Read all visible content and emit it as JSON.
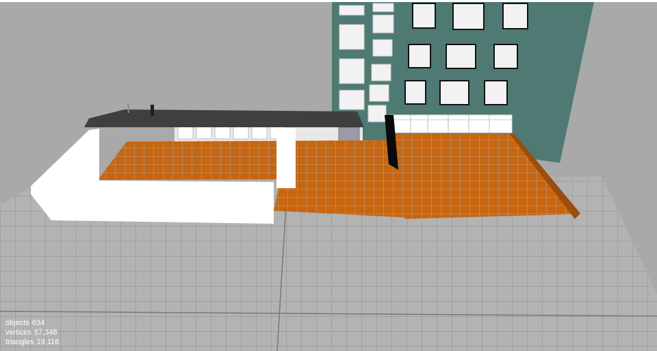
{
  "scene": {
    "background_color": "#a9a9a9",
    "ground_color": "#b3b3b3",
    "ground_grid_color": "#8c8c8c",
    "terrace_color": "#c8650f",
    "terrace_grid_color": "#a9a9a9",
    "building_color": "#4f7a73",
    "roof_color": "#3f3f3f",
    "wall_color": "#ffffff",
    "window_color": "#f2f2f2",
    "railing_color": "#ffffff"
  },
  "stats": {
    "objects_label": "objects",
    "objects_value": "634",
    "vertices_label": "vertices",
    "vertices_value": "57,348",
    "triangles_label": "triangles",
    "triangles_value": "19,116"
  }
}
